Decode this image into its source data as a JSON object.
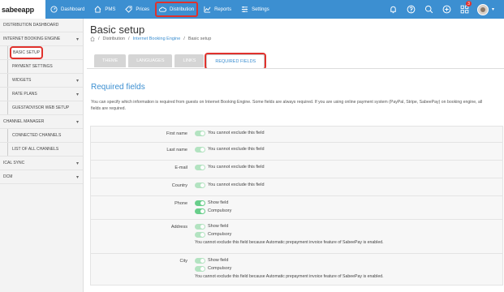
{
  "brand": "sabeeapp",
  "nav": [
    {
      "label": "Dashboard",
      "icon": "gauge-icon"
    },
    {
      "label": "PMS",
      "icon": "home-icon"
    },
    {
      "label": "Prices",
      "icon": "tag-icon"
    },
    {
      "label": "Distribution",
      "icon": "cloud-icon",
      "active": true
    },
    {
      "label": "Reports",
      "icon": "chart-icon"
    },
    {
      "label": "Settings",
      "icon": "sliders-icon"
    }
  ],
  "top_icons": {
    "notification_badge": "3"
  },
  "sidebar": {
    "items": [
      {
        "label": "DISTRIBUTION DASHBOARD"
      },
      {
        "label": "INTERNET BOOKING ENGINE"
      },
      {
        "label": "BASIC SETUP"
      },
      {
        "label": "PAYMENT SETTINGS"
      },
      {
        "label": "WIDGETS"
      },
      {
        "label": "RATE PLANS"
      },
      {
        "label": "GUESTADVISOR WEB SETUP"
      },
      {
        "label": "CHANNEL MANAGER"
      },
      {
        "label": "CONNECTED CHANNELS"
      },
      {
        "label": "LIST OF ALL CHANNELS"
      },
      {
        "label": "ICAL SYNC"
      },
      {
        "label": "DCM"
      }
    ]
  },
  "page": {
    "title": "Basic setup",
    "breadcrumb": [
      "Distribution",
      "Internet Booking Engine",
      "Basic setup"
    ]
  },
  "tabs": [
    "THEME",
    "LANGUAGES",
    "LINKS",
    "REQUIRED FIELDS"
  ],
  "section": {
    "title": "Required fields",
    "description": "You can specify which information is required from guests on Internet Booking Engine. Some fields are always required. If you are using online payment system (PayPal, Stripe, SabeePay) on booking engine, all fields are required."
  },
  "fields": [
    {
      "label": "First name",
      "options": [
        "You cannot exclude this field"
      ],
      "note": ""
    },
    {
      "label": "Last name",
      "options": [
        "You cannot exclude this field"
      ],
      "note": ""
    },
    {
      "label": "E-mail",
      "options": [
        "You cannot exclude this field"
      ],
      "note": ""
    },
    {
      "label": "Country",
      "options": [
        "You cannot exclude this field"
      ],
      "note": ""
    },
    {
      "label": "Phone",
      "options": [
        "Show field",
        "Compulsory"
      ],
      "note": ""
    },
    {
      "label": "Address",
      "options": [
        "Show field",
        "Compulsory"
      ],
      "note": "You cannot exclude this field because Automatic prepayment invoice feature of SabeePay is enabled."
    },
    {
      "label": "City",
      "options": [
        "Show field",
        "Compulsory"
      ],
      "note": "You cannot exclude this field because Automatic prepayment invoice feature of SabeePay is enabled."
    }
  ],
  "colors": {
    "accent": "#3c8fd1",
    "highlight": "#e0322d",
    "toggle": "#50c878"
  }
}
